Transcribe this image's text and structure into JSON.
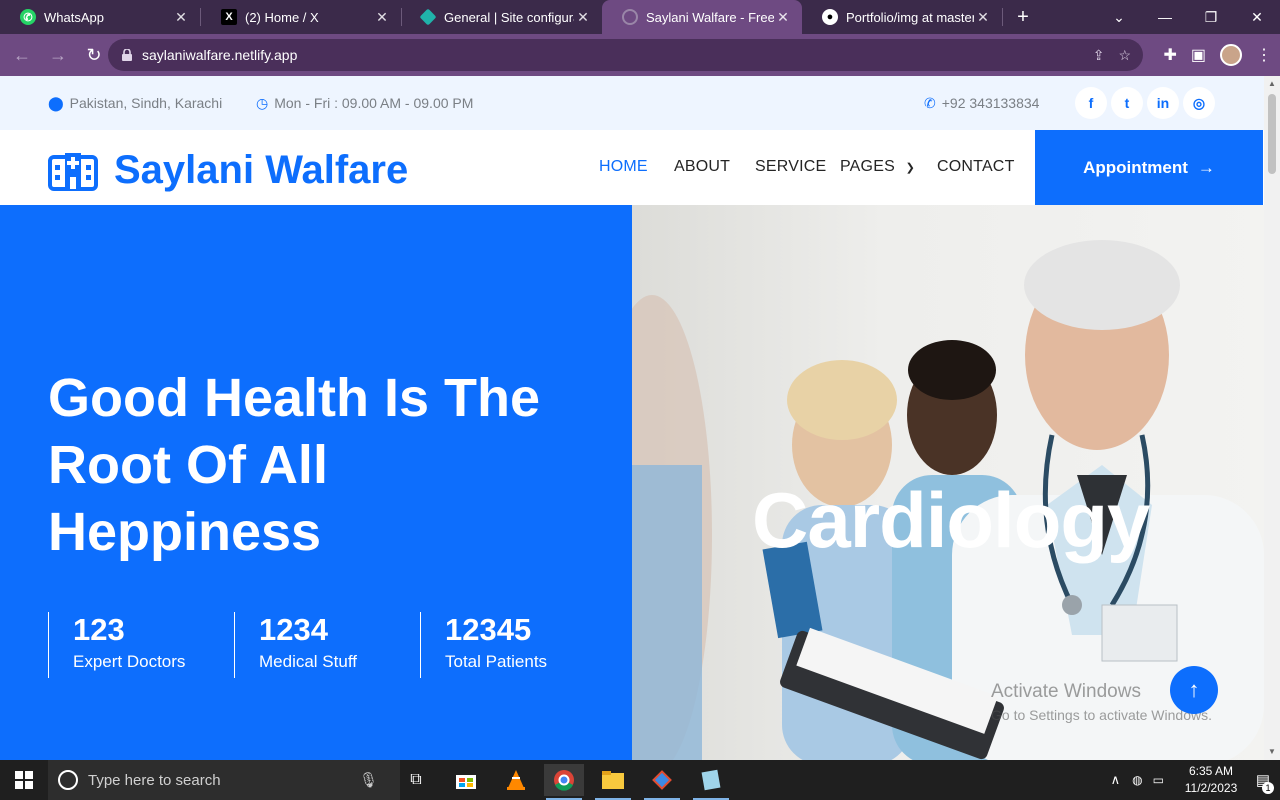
{
  "browser": {
    "tabs": [
      {
        "title": "WhatsApp",
        "icon": "whatsapp-icon",
        "active": false
      },
      {
        "title": "(2) Home / X",
        "icon": "x-icon",
        "active": false
      },
      {
        "title": "General | Site configurati",
        "icon": "netlify-icon",
        "active": false
      },
      {
        "title": "Saylani Walfare - Free He",
        "icon": "globe-icon",
        "active": true
      },
      {
        "title": "Portfolio/img at master ·",
        "icon": "github-icon",
        "active": false
      }
    ],
    "url": "saylaniwalfare.netlify.app"
  },
  "topbar": {
    "location": "Pakistan, Sindh, Karachi",
    "hours": "Mon - Fri : 09.00 AM - 09.00 PM",
    "phone": "+92 343133834"
  },
  "navbar": {
    "brand": "Saylani Walfare",
    "menu": {
      "home": "HOME",
      "about": "ABOUT",
      "service": "SERVICE",
      "pages": "PAGES",
      "contact": "CONTACT"
    },
    "appointment": "Appointment"
  },
  "hero": {
    "title": "Good Health Is The Root Of All Heppiness",
    "stats": [
      {
        "value": "123",
        "label": "Expert Doctors"
      },
      {
        "value": "1234",
        "label": "Medical Stuff"
      },
      {
        "value": "12345",
        "label": "Total Patients"
      }
    ],
    "slide_title": "Cardiology"
  },
  "overlay": {
    "activate_title": "Activate Windows",
    "activate_sub": "Go to Settings to activate Windows."
  },
  "taskbar": {
    "search_placeholder": "Type here to search",
    "time": "6:35 AM",
    "date": "11/2/2023",
    "notifications": "1"
  },
  "colors": {
    "brand_blue": "#0d6efd",
    "chrome_purple": "#6e4a82"
  }
}
